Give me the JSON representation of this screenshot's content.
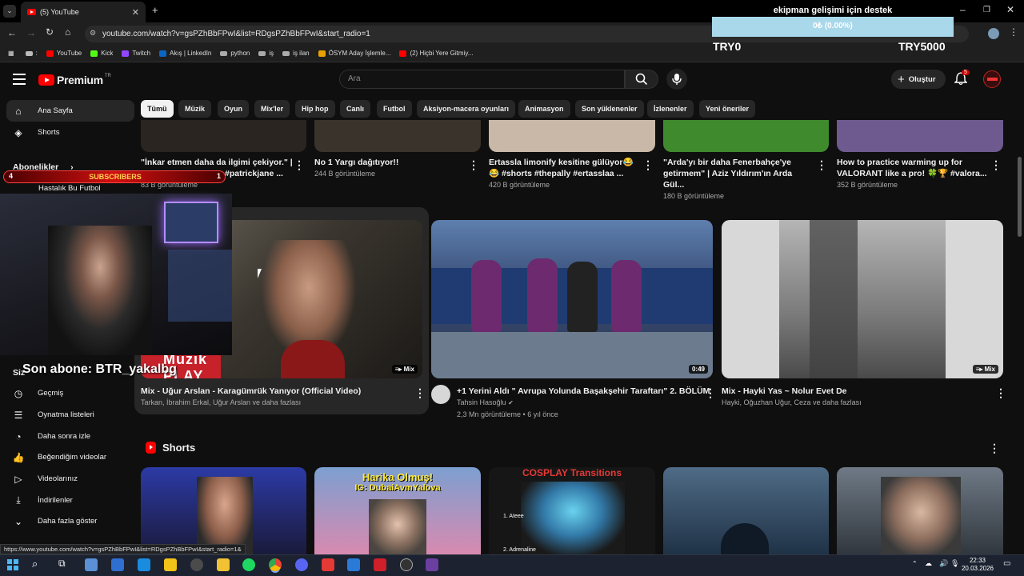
{
  "browser": {
    "tab_title": "(5) YouTube",
    "url": "youtube.com/watch?v=gsPZhBbFPwI&list=RDgsPZhBbFPwI&start_radio=1",
    "bookmarks": [
      "YouTube",
      "Kick",
      "Twitch",
      "Akış | LinkedIn",
      "python",
      "iş",
      "iş ilan",
      "ÖSYM Aday İşlemle...",
      "(2) Hiçbi Yere Gitmiy..."
    ],
    "status_url": "https://www.youtube.com/watch?v=gsPZhBbFPwI&list=RDgsPZhBbFPwI&start_radio=1&"
  },
  "overlay_donation": {
    "title": "ekipman gelişimi için destek",
    "progress_text": "0₺ (0.00%)",
    "progress_fraction": 0.0,
    "min_label": "TRY0",
    "max_label": "TRY5000"
  },
  "overlay_subscribers": {
    "left": "4",
    "label": "SUBSCRIBERS",
    "right": "1"
  },
  "overlay_last_sub": "Son abone: BTR_yakalbg",
  "header": {
    "logo": "Premium",
    "logo_sup": "TR",
    "search_placeholder": "Ara",
    "create_label": "Oluştur",
    "notif_count": "5"
  },
  "chips": [
    "Tümü",
    "Müzik",
    "Oyun",
    "Mix'ler",
    "Hip hop",
    "Canlı",
    "Futbol",
    "Aksiyon-macera oyunları",
    "Animasyon",
    "Son yüklenenler",
    "İzlenenler",
    "Yeni öneriler"
  ],
  "sidebar": {
    "home": "Ana Sayfa",
    "shorts": "Shorts",
    "subs_header": "Abonelikler",
    "sub_item": "Hastalık Bu Futbol",
    "sizin": "Siz",
    "items": [
      "Geçmiş",
      "Oynatma listeleri",
      "Daha sonra izle",
      "Beğendiğim videolar",
      "Videolarınız",
      "İndirilenler",
      "Daha fazla göster"
    ]
  },
  "top_row": [
    {
      "title1": "\"İnkar etmen daha da ilgimi çekiyor.\" |",
      "title2": "#patrickjane ...",
      "meta": "83 B görüntüleme"
    },
    {
      "title1": "No 1 Yargı dağıtıyor!!",
      "title2": "",
      "meta": "244 B görüntüleme"
    },
    {
      "title1": "Ertassla limonify kesitine gülüyor😂",
      "title2": "😂 #shorts #thepally #ertasslaa ...",
      "meta": "420 B görüntüleme"
    },
    {
      "title1": "\"Arda'yı bir daha Fenerbahçe'ye",
      "title2": "getirmem\" | Aziz Yıldırım'ın Arda Gül...",
      "meta": "180 B görüntüleme"
    },
    {
      "title1": "How to practice warming up for",
      "title2": "VALORANT like a pro! 🍀🏆 #valora...",
      "meta": "352 B görüntüleme"
    }
  ],
  "mid_row": [
    {
      "title": "Mix - Uğur Arslan - Karagümrük Yanıyor (Official Video)",
      "meta": "Tarkan, İbrahim Erkal, Uğur Arslan ve daha fazlası",
      "badge": "Mix",
      "overlay_text": "Müzik PLAY"
    },
    {
      "title": "+1 Yerini Aldı \" Avrupa Yolunda Başakşehir Taraftarı\" 2. BÖLÜM",
      "channel": "Tahsin Hasoğlu",
      "meta": "2,3 Mn görüntüleme • 6 yıl önce",
      "badge": "0:49"
    },
    {
      "title": "Mix - Hayki Yas ~ Nolur Evet De",
      "meta": "Hayki, Oğuzhan Uğur, Ceza ve daha fazlası",
      "badge": "Mix"
    }
  ],
  "shorts": {
    "header": "Shorts",
    "thumb2_line1": "Harika Olmuş!",
    "thumb2_line2": "IG: DubaiAvmYalova",
    "thumb3_title": "COSPLAY Transitions",
    "thumb3_sub1": "1. Ateee",
    "thumb3_sub2": "2. Adrenaline"
  },
  "clock": {
    "time": "22:33",
    "date": "20.03.2026"
  },
  "colors": {
    "bg": "#0f0f0f",
    "accent_red": "#ff0000",
    "progress_bar": "#a8d8ea"
  }
}
